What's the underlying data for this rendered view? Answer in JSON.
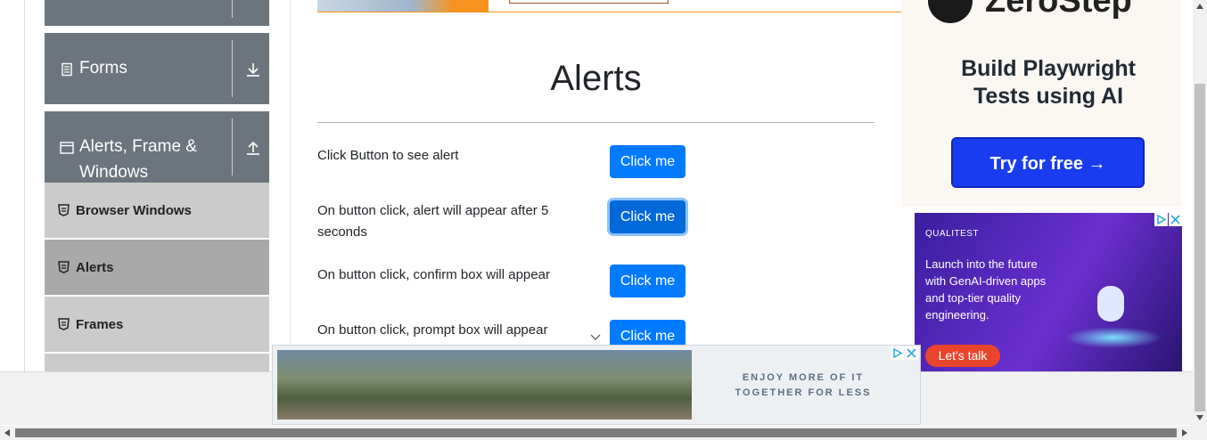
{
  "sidebar": {
    "groups": [
      {
        "title": "Forms",
        "icon": "form-icon",
        "toggle": "download-arrow-icon"
      },
      {
        "title": "Alerts, Frame &",
        "title_line2": "Windows",
        "icon": "window-icon",
        "toggle": "upload-arrow-icon"
      }
    ],
    "items": [
      {
        "label": "Browser Windows",
        "icon": "html5-shield-icon"
      },
      {
        "label": "Alerts",
        "icon": "html5-shield-icon",
        "active": true
      },
      {
        "label": "Frames",
        "icon": "html5-shield-icon"
      }
    ]
  },
  "main": {
    "title": "Alerts",
    "rows": [
      {
        "label": "Click Button to see alert",
        "button": "Click me"
      },
      {
        "label": "On button click, alert will appear after 5 seconds",
        "button": "Click me"
      },
      {
        "label": "On button click, confirm box will appear",
        "button": "Click me"
      },
      {
        "label": "On button click, prompt box will appear",
        "button": "Click me"
      }
    ]
  },
  "ads": {
    "zerostep": {
      "brand": "ZeroStep",
      "headline_1": "Build Playwright",
      "headline_2": "Tests using AI",
      "cta": "Try for free →"
    },
    "qualitest": {
      "brand": "QUALITEST",
      "text": "Launch into the future with GenAI-driven apps and top-tier quality engineering.",
      "cta": "Let's talk"
    },
    "bottom": {
      "line_1": "ENJOY MORE OF IT",
      "line_2": "TOGETHER FOR LESS"
    }
  },
  "colors": {
    "primary_button": "#007bff",
    "sidebar_group": "#6c757d",
    "sidebar_item": "#cbcbcb",
    "sidebar_active": "#a9a9a9"
  }
}
